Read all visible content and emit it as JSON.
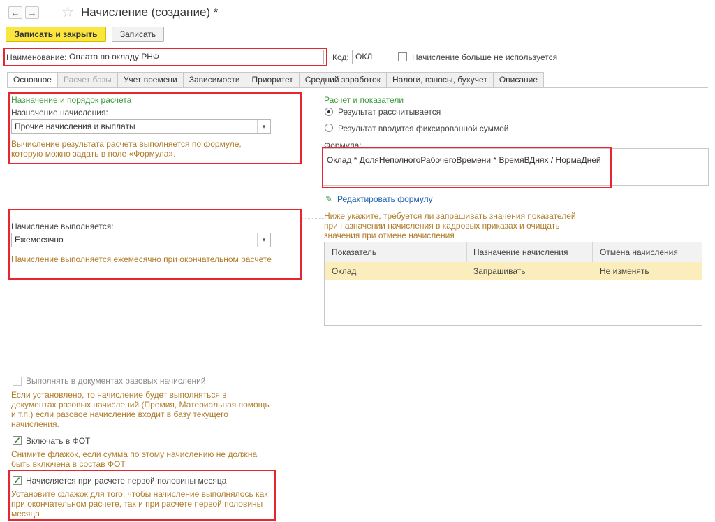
{
  "window": {
    "title": "Начисление (создание) *",
    "back_glyph": "←",
    "forward_glyph": "→",
    "favorite_glyph": "☆"
  },
  "toolbar": {
    "save_close_label": "Записать и закрыть",
    "save_label": "Записать"
  },
  "header": {
    "name_label": "Наименование:",
    "name_value": "Оплата по окладу РНФ",
    "code_label": "Код:",
    "code_value": "ОКЛ",
    "unused_checkbox_label": "Начисление больше не используется"
  },
  "tabs": [
    {
      "label": "Основное"
    },
    {
      "label": "Расчет базы"
    },
    {
      "label": "Учет времени"
    },
    {
      "label": "Зависимости"
    },
    {
      "label": "Приоритет"
    },
    {
      "label": "Средний заработок"
    },
    {
      "label": "Налоги, взносы, бухучет"
    },
    {
      "label": "Описание"
    }
  ],
  "left": {
    "section_title": "Назначение и порядок расчета",
    "purpose_label": "Назначение начисления:",
    "purpose_value": "Прочие начисления и выплаты",
    "purpose_hint_1": "Вычисление результата расчета выполняется по формуле,",
    "purpose_hint_2": "которую можно задать в поле «Формула».",
    "schedule_label": "Начисление выполняется:",
    "schedule_value": "Ежемесячно",
    "schedule_hint": "Начисление выполняется ежемесячно при окончательном расчете",
    "one_time_label": "Выполнять в документах разовых начислений",
    "one_time_hint": [
      "Если установлено, то начисление будет выполняться в",
      "документах разовых начислений (Премия, Материальная помощь",
      "и т.п.) если разовое начисление входит в базу текущего",
      "начисления."
    ],
    "fot_label": "Включать в ФОТ",
    "fot_hint": [
      "Снимите флажок, если сумма по этому начислению не должна",
      "быть включена в состав ФОТ"
    ],
    "half_month_label": "Начисляется при расчете первой половины месяца",
    "half_month_hint": [
      "Установите флажок для того, чтобы начисление выполнялось как",
      "при окончательном расчете, так и при расчете первой половины",
      "месяца"
    ]
  },
  "right": {
    "section_title": "Расчет и показатели",
    "radio_calculated": "Результат рассчитывается",
    "radio_fixed": "Результат вводится фиксированной суммой",
    "formula_label": "Формула:",
    "formula_value": "Оклад * ДоляНеполногоРабочегоВремени * ВремяВДнях / НормаДней",
    "edit_formula_link": "Редактировать формулу",
    "indicators_hint": [
      "Ниже укажите, требуется ли запрашивать значения показателей",
      "при назначении начисления в кадровых приказах и очищать",
      "значения при отмене начисления"
    ],
    "table": {
      "columns": [
        "Показатель",
        "Назначение начисления",
        "Отмена начисления"
      ],
      "rows": [
        [
          "Оклад",
          "Запрашивать",
          "Не изменять"
        ]
      ]
    }
  },
  "colors": {
    "highlight_border": "#e8262f",
    "primary_button": "#fbe63f",
    "section_title": "#3a9a3a",
    "hint_text": "#b07c2a",
    "selected_row": "#fbeebc"
  }
}
